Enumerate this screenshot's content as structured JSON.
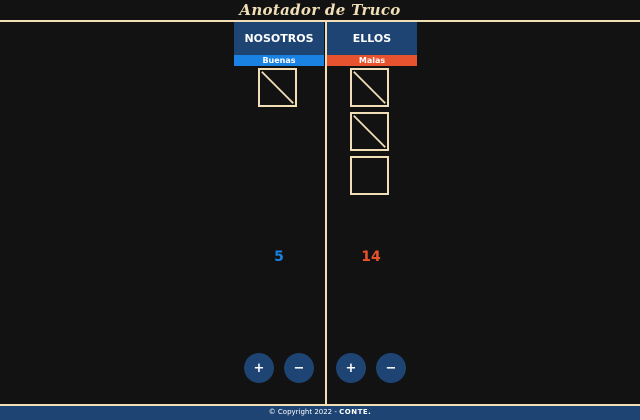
{
  "app": {
    "title": "Anotador de Truco"
  },
  "teams": [
    {
      "name": "NOSOTROS",
      "status": "Buenas",
      "status_color": "#1a82e2",
      "score": 5,
      "score_color": "#1a82e2"
    },
    {
      "name": "ELLOS",
      "status": "Malas",
      "status_color": "#e6532e",
      "score": 14,
      "score_color": "#e6532e"
    }
  ],
  "controls": {
    "plus_symbol": "+",
    "minus_symbol": "−"
  },
  "footer": {
    "copyright": "© Copyright 2022 -",
    "brand": "CONTE."
  },
  "colors": {
    "background": "#121212",
    "accent": "#f1deb7",
    "panel": "#1e4473"
  }
}
